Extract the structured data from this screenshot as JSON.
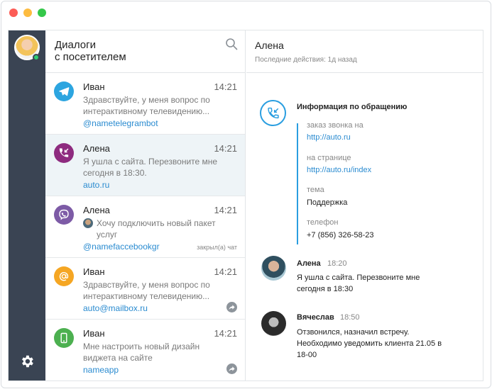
{
  "sidebar": {
    "agent_status": "online",
    "settings_icon": "gear-icon"
  },
  "list": {
    "title": "Диалоги\nс посетителем",
    "search_icon": "search-icon",
    "items": [
      {
        "name": "Иван",
        "time": "14:21",
        "text": "Здравствуйте, у меня вопрос по интерактивному телевидению...",
        "link": "@nametelegrambot",
        "channel_icon": "telegram-icon",
        "color": "#2ca5e0"
      },
      {
        "name": "Алена",
        "time": "14:21",
        "text": "Я ушла с сайта. Перезвоните мне сегодня в 18:30.",
        "link": "auto.ru",
        "channel_icon": "phone-callback-icon",
        "color": "#8e2b7f",
        "active": true
      },
      {
        "name": "Алена",
        "time": "14:21",
        "text": "Хочу подключить новый пакет услуг",
        "link": "@namefaccebookgr",
        "closed": "закрыл(а) чат",
        "channel_icon": "viber-icon",
        "color": "#7d5ba6"
      },
      {
        "name": "Иван",
        "time": "14:21",
        "text": "Здравствуйте, у меня вопрос по интерактивному телевидению...",
        "link": "auto@mailbox.ru",
        "channel_icon": "email-icon",
        "color": "#f5a623"
      },
      {
        "name": "Иван",
        "time": "14:21",
        "text": "Мне настроить новый дизайн виджета на сайте",
        "link": "nameapp",
        "channel_icon": "mobile-app-icon",
        "color": "#4cb050"
      }
    ]
  },
  "detail": {
    "name": "Алена",
    "status": "Последние действия: 1д назад",
    "info": {
      "title": "Информация по обращению",
      "fields": [
        {
          "label": "заказ звонка на",
          "value": "http://auto.ru",
          "link": true
        },
        {
          "label": "на странице",
          "value": "http://auto.ru/index",
          "link": true
        },
        {
          "label": "тема",
          "value": "Поддержка",
          "link": false
        },
        {
          "label": "телефон",
          "value": "+7 (856) 326-58-23",
          "link": false
        }
      ]
    },
    "messages": [
      {
        "name": "Алена",
        "time": "18:20",
        "text": "Я ушла с сайта. Перезвоните мне сегодня в 18:30"
      },
      {
        "name": "Вячеслав",
        "time": "18:50",
        "text": "Отзвонился, назначил встречу. Необходимо уведомить клиента 21.05 в 18-00"
      }
    ]
  },
  "colors": {
    "accent": "#2a9ee0",
    "rail": "#3a4453",
    "active_row": "#eef4f7"
  }
}
